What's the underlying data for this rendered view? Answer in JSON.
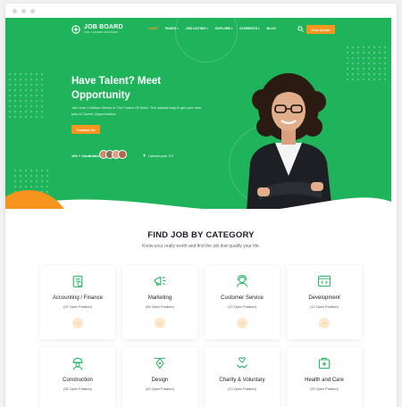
{
  "nav": {
    "logo_title": "JOB BOARD",
    "logo_sub": "THE CAREER MASTERS",
    "items": [
      {
        "label": "HOME",
        "active": true,
        "caret": false
      },
      {
        "label": "PAGES",
        "active": false,
        "caret": true
      },
      {
        "label": "JOB LISTING",
        "active": false,
        "caret": true
      },
      {
        "label": "EXPLORE",
        "active": false,
        "caret": true
      },
      {
        "label": "ELEMENTS",
        "active": false,
        "caret": true
      },
      {
        "label": "BLOG",
        "active": false,
        "caret": false
      }
    ],
    "cta_label": "Free Quote"
  },
  "hero": {
    "title": "Have Talent? Meet Opportunity",
    "description": "Join over 2 Million Others in The Future Of Work. The easiest way to get your new jobs & Career Opportunities.",
    "button_label": "Contact Us",
    "candidates": "10k + Candidates",
    "upload_label": "Upload your CV"
  },
  "section": {
    "title": "FIND JOB BY CATEGORY",
    "subtitle": "Know your really worth and find the job that qualify your life."
  },
  "categories": [
    {
      "name": "Accounting / Finance",
      "positions": "(02 Open Position)",
      "icon": "finance-icon"
    },
    {
      "name": "Marketing",
      "positions": "(86 Open Position)",
      "icon": "megaphone-icon"
    },
    {
      "name": "Customer Service",
      "positions": "(20 Open Position)",
      "icon": "support-agent-icon"
    },
    {
      "name": "Development",
      "positions": "(12 Open Position)",
      "icon": "code-window-icon"
    },
    {
      "name": "Construction",
      "positions": "(55 Open Position)",
      "icon": "construction-worker-icon"
    },
    {
      "name": "Design",
      "positions": "(43 Open Position)",
      "icon": "pen-tool-icon"
    },
    {
      "name": "Charity & Voluntary",
      "positions": "(12 Open Position)",
      "icon": "charity-hands-icon"
    },
    {
      "name": "Health and Care",
      "positions": "(25 Open Position)",
      "icon": "medical-kit-icon"
    }
  ],
  "colors": {
    "brand_green": "#1fb35c",
    "accent_orange": "#f7941d"
  }
}
